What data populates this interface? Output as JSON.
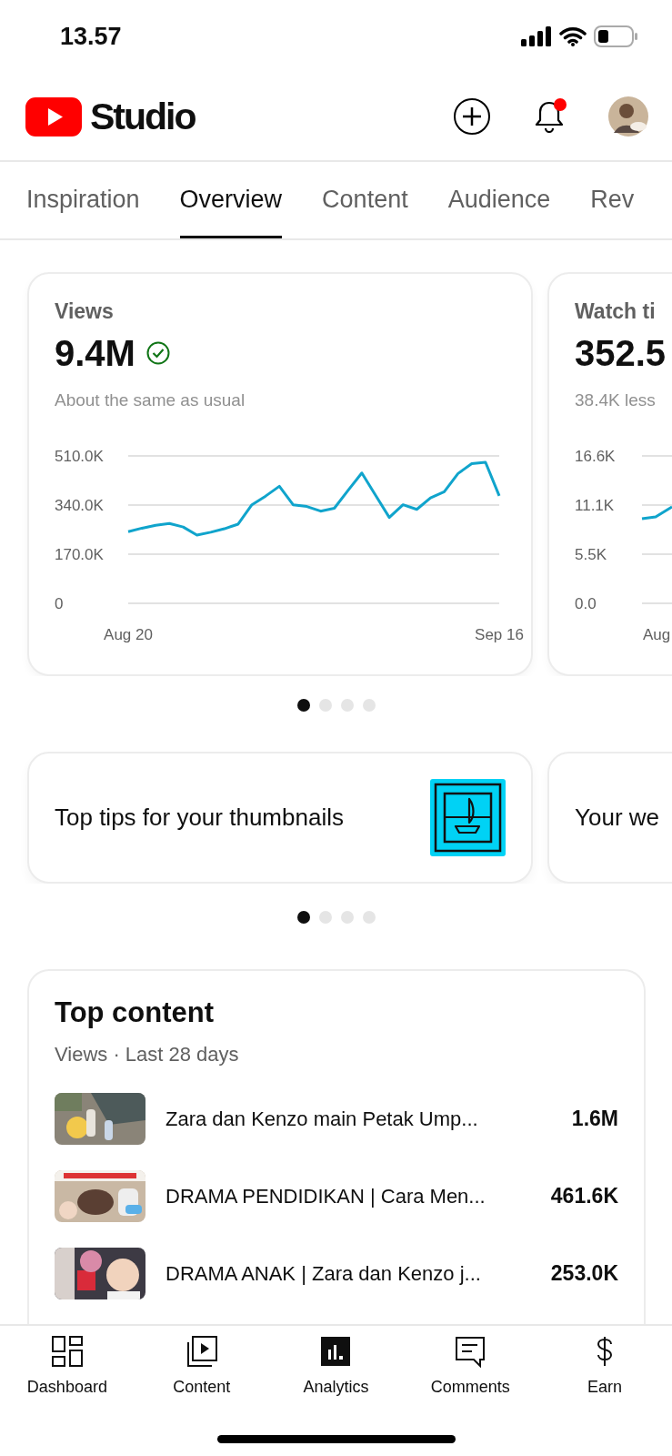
{
  "status_bar": {
    "time": "13.57"
  },
  "header": {
    "title": "Studio",
    "notification_dot": true
  },
  "tabs": [
    {
      "label": "Inspiration",
      "selected": false
    },
    {
      "label": "Overview",
      "selected": true
    },
    {
      "label": "Content",
      "selected": false
    },
    {
      "label": "Audience",
      "selected": false
    },
    {
      "label": "Rev",
      "selected": false
    }
  ],
  "metric_cards": [
    {
      "title": "Views",
      "value": "9.4M",
      "verified": true,
      "note": "About the same as usual",
      "chart_data": {
        "type": "line",
        "categories": [
          "Aug 20",
          null,
          null,
          null,
          null,
          null,
          null,
          null,
          null,
          null,
          null,
          null,
          null,
          null,
          null,
          null,
          null,
          null,
          null,
          null,
          null,
          null,
          null,
          null,
          null,
          null,
          null,
          "Sep 16"
        ],
        "ylim": [
          0,
          510
        ],
        "yticks": [
          {
            "value": 510,
            "label": "510.0K"
          },
          {
            "value": 340,
            "label": "340.0K"
          },
          {
            "value": 170,
            "label": "170.0K"
          },
          {
            "value": 0,
            "label": "0"
          }
        ],
        "series": [
          {
            "color": "#10a4cc",
            "values": [
              248,
              260,
              270,
              276,
              264,
              236,
              246,
              258,
              274,
              341,
              371,
              405,
              341,
              335,
              319,
              329,
              391,
              451,
              374,
              297,
              341,
              325,
              365,
              386,
              449,
              483,
              488,
              372
            ]
          }
        ]
      }
    },
    {
      "title": "Watch ti",
      "value": "352.5",
      "note": "38.4K less",
      "axis": {
        "y_labels": [
          "16.6K",
          "11.1K",
          "5.5K",
          "0.0"
        ],
        "x_labels": [
          "Aug"
        ]
      }
    }
  ],
  "metric_pager": [
    {
      "selected": true
    },
    {
      "selected": false
    },
    {
      "selected": false
    },
    {
      "selected": false
    }
  ],
  "tip_cards": [
    {
      "title": "Top tips for your thumbnails"
    },
    {
      "title": "Your we"
    }
  ],
  "tip_pager": [
    {
      "selected": true
    },
    {
      "selected": false
    },
    {
      "selected": false
    },
    {
      "selected": false
    }
  ],
  "top_content": {
    "title": "Top content",
    "subtitle": "Views · Last 28 days",
    "rows": [
      {
        "title": "Zara dan Kenzo main Petak Ump...",
        "value": "1.6M"
      },
      {
        "title": "DRAMA PENDIDIKAN | Cara Men...",
        "value": "461.6K"
      },
      {
        "title": "DRAMA ANAK | Zara dan Kenzo j...",
        "value": "253.0K"
      }
    ]
  },
  "bottom_nav": [
    {
      "label": "Dashboard",
      "selected": false
    },
    {
      "label": "Content",
      "selected": false
    },
    {
      "label": "Analytics",
      "selected": true
    },
    {
      "label": "Comments",
      "selected": false
    },
    {
      "label": "Earn",
      "selected": false
    }
  ]
}
